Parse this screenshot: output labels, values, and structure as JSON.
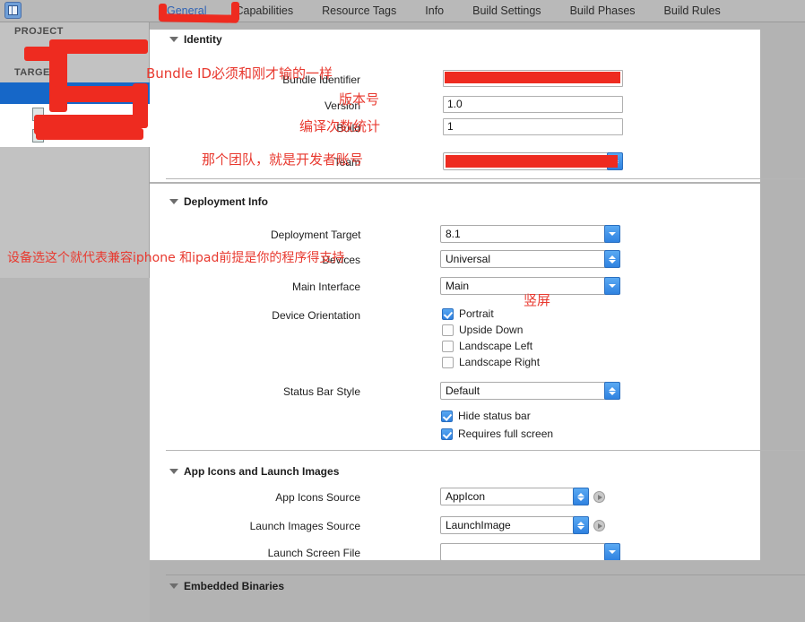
{
  "window": {
    "app": "Xcode",
    "nav_toggle_icon": "navigator-toggle-icon"
  },
  "tabs": [
    {
      "label": "General",
      "active": true
    },
    {
      "label": "Capabilities",
      "active": false
    },
    {
      "label": "Resource Tags",
      "active": false
    },
    {
      "label": "Info",
      "active": false
    },
    {
      "label": "Build Settings",
      "active": false
    },
    {
      "label": "Build Phases",
      "active": false
    },
    {
      "label": "Build Rules",
      "active": false
    }
  ],
  "sidebar": {
    "project_header": "PROJECT",
    "targets_header": "TARGETS",
    "project_item": "",
    "target_items": [
      "",
      ""
    ]
  },
  "sections": {
    "identity": {
      "title": "Identity",
      "fields": {
        "bundle_identifier_label": "Bundle Identifier",
        "bundle_identifier_value": "",
        "version_label": "Version",
        "version_value": "1.0",
        "build_label": "Build",
        "build_value": "1",
        "team_label": "Team",
        "team_value": ""
      }
    },
    "deployment_info": {
      "title": "Deployment Info",
      "fields": {
        "deployment_target_label": "Deployment Target",
        "deployment_target_value": "8.1",
        "devices_label": "Devices",
        "devices_value": "Universal",
        "main_interface_label": "Main Interface",
        "main_interface_value": "Main",
        "device_orientation_label": "Device Orientation",
        "status_bar_style_label": "Status Bar Style",
        "status_bar_style_value": "Default"
      },
      "orientations": [
        {
          "label": "Portrait",
          "checked": true
        },
        {
          "label": "Upside Down",
          "checked": false
        },
        {
          "label": "Landscape Left",
          "checked": false
        },
        {
          "label": "Landscape Right",
          "checked": false
        }
      ],
      "status_options": [
        {
          "label": "Hide status bar",
          "checked": true
        },
        {
          "label": "Requires full screen",
          "checked": true
        }
      ]
    },
    "app_icons": {
      "title": "App Icons and Launch Images",
      "fields": {
        "app_icons_source_label": "App Icons Source",
        "app_icons_source_value": "AppIcon",
        "launch_images_source_label": "Launch Images Source",
        "launch_images_source_value": "LaunchImage",
        "launch_screen_file_label": "Launch Screen File",
        "launch_screen_file_value": ""
      }
    },
    "embedded_binaries": {
      "title": "Embedded Binaries"
    }
  },
  "annotations": [
    {
      "id": "bundle_id_note",
      "text": "Bundle ID必须和刚才输的一样"
    },
    {
      "id": "version_note",
      "text": "版本号"
    },
    {
      "id": "build_note",
      "text": "编译次数统计"
    },
    {
      "id": "team_note",
      "text": "那个团队，就是开发者账号"
    },
    {
      "id": "devices_note",
      "text": "设备选这个就代表兼容iphone 和ipad前提是你的程序得支持"
    },
    {
      "id": "portrait_note",
      "text": "竖屏"
    }
  ],
  "colors": {
    "accent_blue": "#2f62b4",
    "selection_blue": "#1667c8",
    "annotation_red": "#e8392f",
    "redaction_red": "#ee2b20",
    "control_blue": "#2f82e0",
    "window_gray": "#b3b3b3"
  }
}
